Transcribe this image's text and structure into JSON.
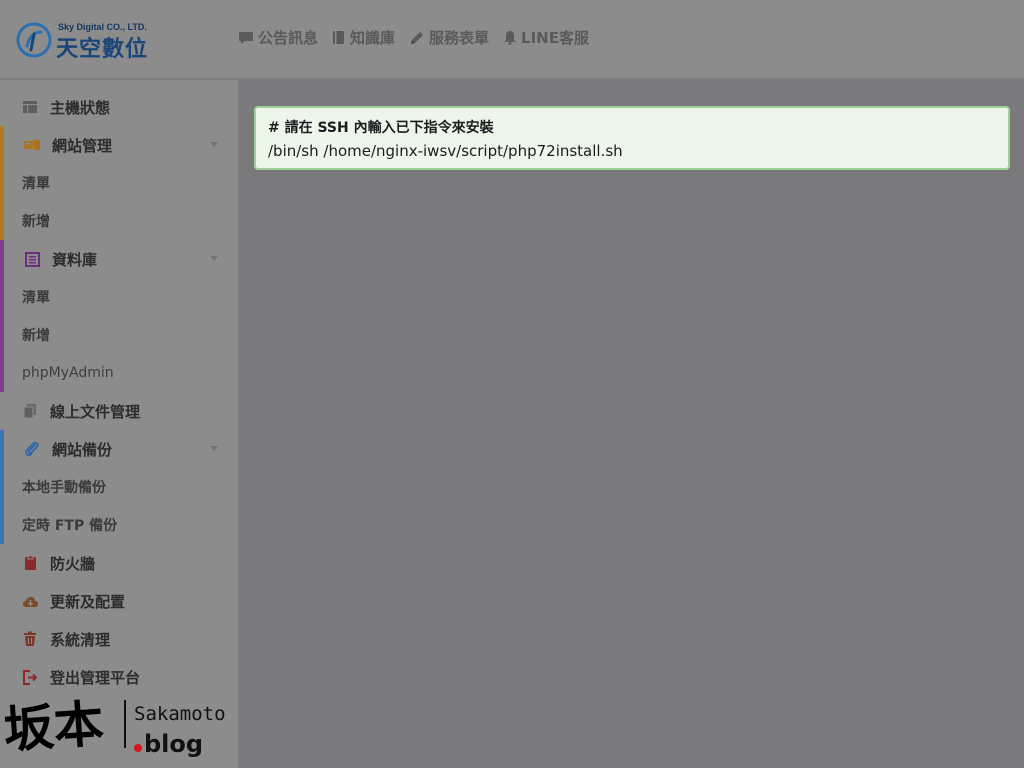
{
  "brand": {
    "company_en": "Sky Digital CO., LTD.",
    "name": "天空數位"
  },
  "topnav": [
    {
      "label": "公告訊息",
      "icon": "comment-icon"
    },
    {
      "label": "知識庫",
      "icon": "book-icon"
    },
    {
      "label": "服務表單",
      "icon": "pencil-icon"
    },
    {
      "label": "LINE客服",
      "icon": "bell-icon"
    }
  ],
  "sidebar": {
    "host_status": "主機狀態",
    "website": {
      "label": "網站管理",
      "list": "清單",
      "add": "新增"
    },
    "database": {
      "label": "資料庫",
      "list": "清單",
      "add": "新增",
      "phpmyadmin": "phpMyAdmin"
    },
    "files": "線上文件管理",
    "backup": {
      "label": "網站備份",
      "manual": "本地手動備份",
      "ftp": "定時 FTP 備份"
    },
    "firewall": "防火牆",
    "update": "更新及配置",
    "cleanup": "系統清理",
    "logout": "登出管理平台"
  },
  "main": {
    "comment": "# 請在 SSH 內輸入已下指令來安裝",
    "command": "/bin/sh /home/nginx-iwsv/script/php72install.sh"
  },
  "watermark": {
    "kanji": "坂本",
    "site": "Sakamoto",
    "tld": ".blog"
  },
  "colors": {
    "accent_website": "#b07a22",
    "accent_database": "#7e3f8f",
    "accent_backup": "#3f74b3",
    "command_bg": "#eef6ec",
    "command_border": "#9fcf9a"
  }
}
